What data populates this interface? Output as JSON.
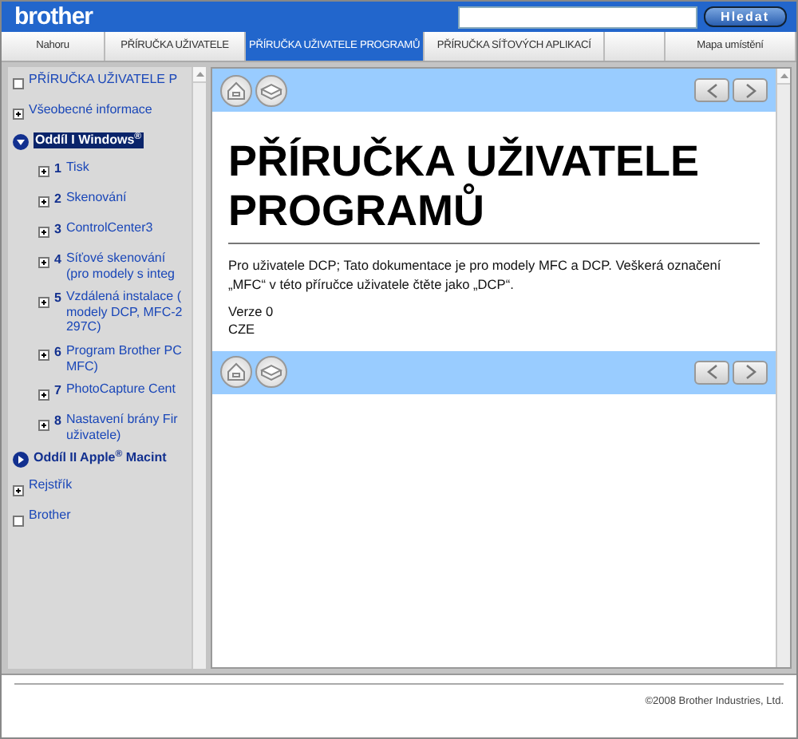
{
  "header": {
    "logo": "brother",
    "search_button": "Hledat"
  },
  "tabs": [
    {
      "label": "Nahoru",
      "selected": false
    },
    {
      "label": "PŘÍRUČKA UŽIVATELE",
      "selected": false
    },
    {
      "label": "PŘÍRUČKA UŽIVATELE PROGRAMŮ",
      "selected": true
    },
    {
      "label": "PŘÍRUČKA SÍŤOVÝCH APLIKACÍ",
      "selected": false
    },
    {
      "label": "Mapa umístění",
      "selected": false
    }
  ],
  "sidebar": {
    "items": [
      {
        "kind": "page",
        "lines": [
          "PŘÍRUČKA UŽIVATELE P"
        ],
        "selected": false
      },
      {
        "kind": "book",
        "lines": [
          "Všeobecné informace"
        ],
        "selected": false
      },
      {
        "kind": "section",
        "lines": [
          "Oddíl I Windows$^{®}$"
        ],
        "selected": true,
        "expanded": true,
        "children": [
          {
            "kind": "book",
            "number": "1",
            "lines": [
              "Tisk"
            ],
            "selected": false
          },
          {
            "kind": "book",
            "number": "2",
            "lines": [
              "Skenování"
            ],
            "selected": false
          },
          {
            "kind": "book",
            "number": "3",
            "lines": [
              "ControlCenter3"
            ],
            "selected": false
          },
          {
            "kind": "book",
            "number": "4",
            "lines": [
              "Síťové skenování",
              "(pro modely s integ"
            ],
            "selected": false
          },
          {
            "kind": "book",
            "number": "5",
            "lines": [
              "Vzdálená instalace (",
              "modely DCP, MFC-2",
              "297C)"
            ],
            "selected": false
          },
          {
            "kind": "book",
            "number": "6",
            "lines": [
              "Program Brother PC",
              "MFC)"
            ],
            "selected": false
          },
          {
            "kind": "book",
            "number": "7",
            "lines": [
              "PhotoCapture Cent"
            ],
            "selected": false
          },
          {
            "kind": "book",
            "number": "8",
            "lines": [
              "Nastavení brány Fir",
              "uživatele)"
            ],
            "selected": false
          }
        ]
      },
      {
        "kind": "section",
        "lines": [
          "Oddíl II Apple$^{®}$ Macint"
        ],
        "selected": false,
        "expanded": false
      },
      {
        "kind": "book",
        "lines": [
          "Rejstřík"
        ],
        "selected": false
      },
      {
        "kind": "page",
        "lines": [
          "Brother"
        ],
        "selected": false
      }
    ]
  },
  "content": {
    "title": "PŘÍRUČKA UŽIVATELE PROGRAMŮ",
    "paragraph": "Pro uživatele DCP; Tato dokumentace je pro modely MFC a DCP. Veškerá označení „MFC“ v této příručce uživatele čtěte jako „DCP“.",
    "version_lines": [
      "Verze 0",
      "CZE"
    ]
  },
  "footer": {
    "copyright": "©2008 Brother Industries, Ltd."
  }
}
